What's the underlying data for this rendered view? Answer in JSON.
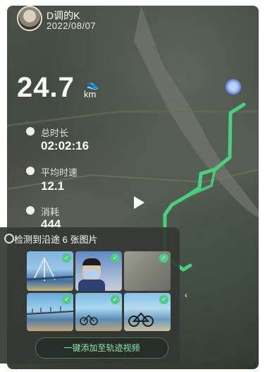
{
  "header": {
    "username": "D调的K",
    "date": "2022/08/07"
  },
  "workout": {
    "distance": "24.7",
    "distance_unit": "km",
    "duration_label": "总时长",
    "duration_value": "02:02:16",
    "avg_speed_label": "平均时速",
    "avg_speed_value": "12.1",
    "calories_label": "消耗",
    "calories_value": "444"
  },
  "photos": {
    "title": "检测到沿途 6 张图片",
    "count": 6
  },
  "actions": {
    "add_to_video": "一键添加至轨迹视频"
  },
  "colors": {
    "route": "#47d17f",
    "accent": "#4ecb85"
  },
  "icons": {
    "run_icon": "running-shoe-icon",
    "clock_icon": "clock-icon",
    "speed_icon": "speedometer-icon",
    "fire_icon": "fire-icon",
    "photo_icon": "camera-icon",
    "play_icon": "play-icon",
    "collapse_icon": "chevron-left-icon"
  }
}
